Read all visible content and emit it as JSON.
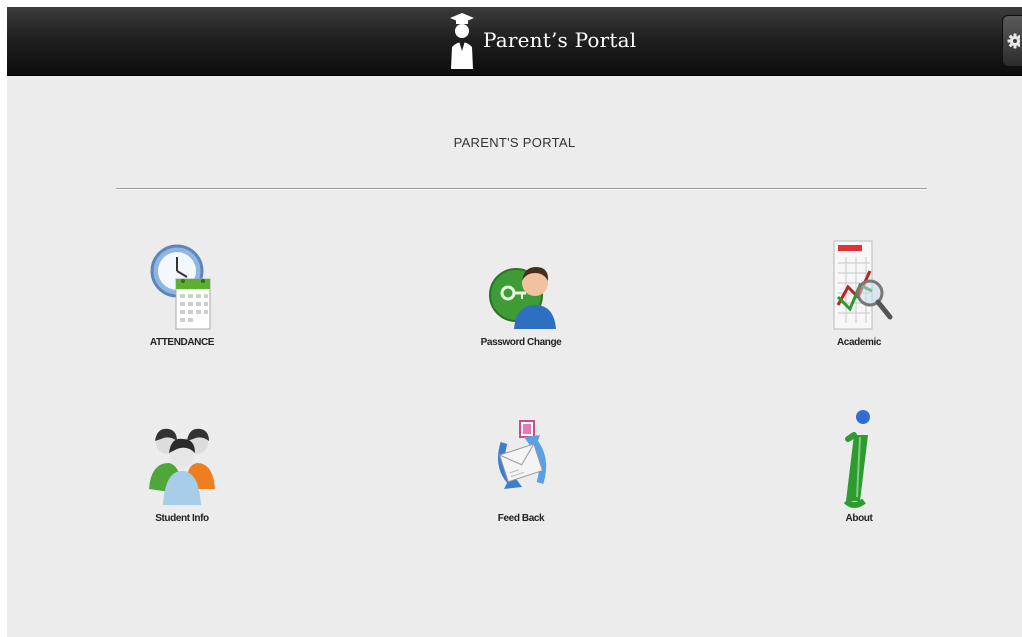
{
  "header": {
    "title": "Parent’s Portal",
    "logo_icon": "graduate-icon",
    "settings_icon": "gear-icon"
  },
  "page": {
    "heading": "PARENT'S PORTAL"
  },
  "menu": [
    {
      "label": "ATTENDANCE",
      "icon": "clock-calendar-icon"
    },
    {
      "label": "Password Change",
      "icon": "user-key-icon"
    },
    {
      "label": "Academic",
      "icon": "results-chart-icon"
    },
    {
      "label": "Student Info",
      "icon": "group-users-icon"
    },
    {
      "label": "Feed Back",
      "icon": "envelope-refresh-icon"
    },
    {
      "label": "About",
      "icon": "info-icon"
    }
  ],
  "colors": {
    "header_bg": "#1e1e1e",
    "page_bg": "#ececec",
    "header_text": "#ffffff"
  }
}
